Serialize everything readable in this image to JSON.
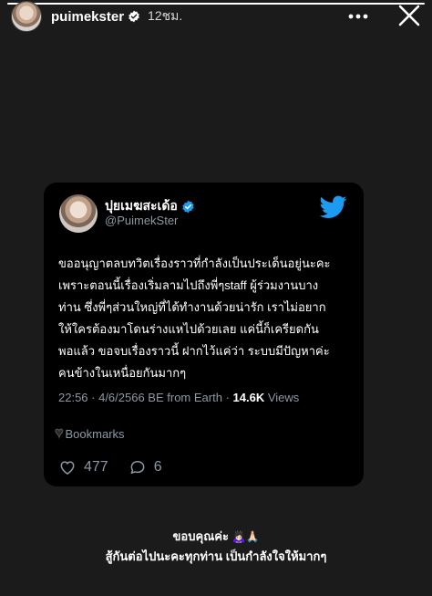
{
  "story": {
    "progress": 1.0,
    "username": "puimekster",
    "time": "12ชม."
  },
  "tweet": {
    "display_name": "ปุยเมฆสะเด้อ",
    "handle": "@PuimekSter",
    "body": "ขออนุญาตลบทวิตเรื่องราวที่กำลังเป็นประเด็นอยู่นะคะ\nเพราะตอนนี้เรื่องเริ่มลามไปถึงพี่ๆstaff ผู้ร่วมงานบาง\nท่าน ซึ่งพี่ๆส่วนใหญ่ที่ได้ทำงานด้วยน่ารัก เราไม่อยาก\nให้ใครต้องมาโดนร่างแหไปด้วยเลย แค่นี้ก็เครียดกัน\nพอแล้ว ขอจบเรื่องราวนี้ ฝากไว้แค่ว่า ระบบมีปัญหาค่ะ\nคนข้างในเหนื่อยกันมากๆ",
    "timestamp": "22:56 · 4/6/2566 BE from Earth",
    "views_count": "14.6K",
    "views_label": "Views",
    "bookmarks_label": "Bookmarks",
    "likes": "477",
    "replies": "6"
  },
  "caption": {
    "line1": "ขอบคุณค่ะ",
    "line1_emoji": "🙇🏻‍♀️🙏🏻",
    "line2": "สู้กันต่อไปนะคะทุกท่าน เป็นกำลังใจให้มากๆ"
  },
  "colors": {
    "background": "#1b1b1b",
    "card": "#000000",
    "twitter_blue": "#1d9bf0",
    "muted": "#8b98a5"
  },
  "icons": [
    "verified-badge-icon",
    "more-icon",
    "close-icon",
    "twitter-bird-icon",
    "heart-icon",
    "reply-icon"
  ]
}
